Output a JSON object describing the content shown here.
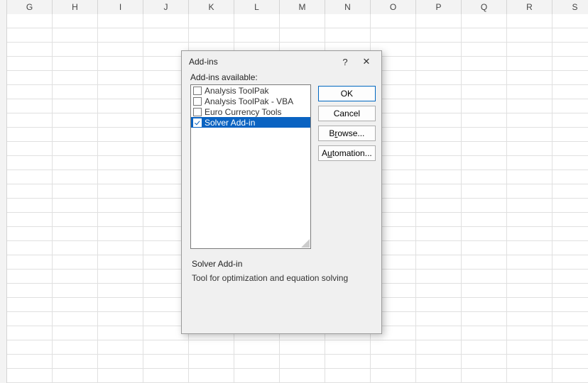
{
  "columns": [
    "G",
    "H",
    "I",
    "J",
    "K",
    "L",
    "M",
    "N",
    "O",
    "P",
    "Q",
    "R",
    "S"
  ],
  "dialog": {
    "title": "Add-ins",
    "help_icon": "?",
    "close_icon": "✕",
    "list_label": "Add-ins available:",
    "addins": [
      {
        "label": "Analysis ToolPak",
        "checked": false,
        "selected": false
      },
      {
        "label": "Analysis ToolPak - VBA",
        "checked": false,
        "selected": false
      },
      {
        "label": "Euro Currency Tools",
        "checked": false,
        "selected": false
      },
      {
        "label": "Solver Add-in",
        "checked": true,
        "selected": true
      }
    ],
    "buttons": {
      "ok": "OK",
      "cancel": "Cancel",
      "browse_pre": "B",
      "browse_u": "r",
      "browse_post": "owse...",
      "automation_pre": "A",
      "automation_u": "u",
      "automation_post": "tomation..."
    },
    "description": {
      "title": "Solver Add-in",
      "text": "Tool for optimization and equation solving"
    }
  }
}
